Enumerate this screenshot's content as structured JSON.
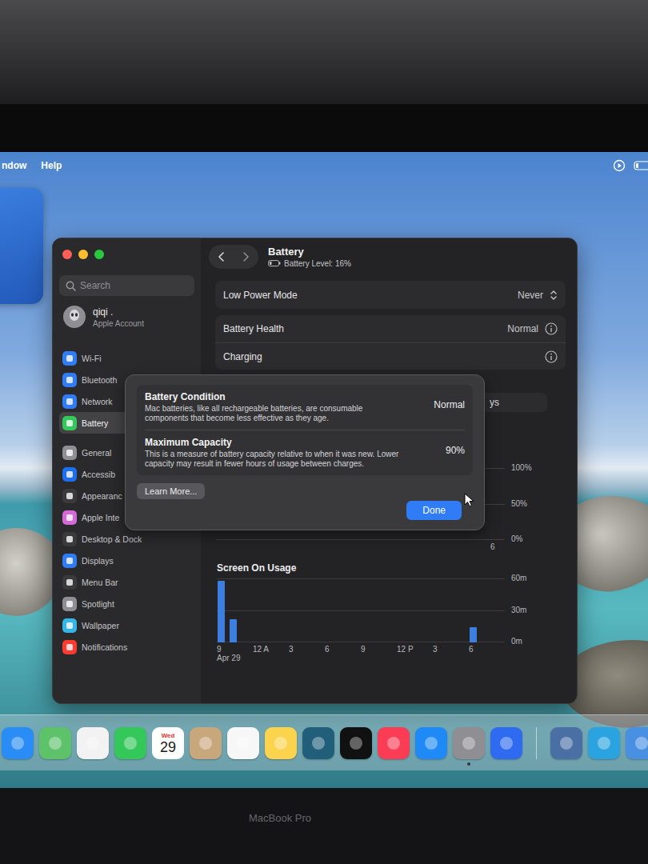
{
  "menu_bar": {
    "items": [
      "ndow",
      "Help"
    ]
  },
  "settings": {
    "sidebar": {
      "search": {
        "placeholder": "Search"
      },
      "account": {
        "name": "qiqi .",
        "subtitle": "Apple Account"
      },
      "items": [
        {
          "label": "Wi-Fi",
          "selected": false,
          "color": "#2f7cf6"
        },
        {
          "label": "Bluetooth",
          "selected": false,
          "color": "#2f7cf6"
        },
        {
          "label": "Network",
          "selected": false,
          "color": "#2f7cf6"
        },
        {
          "label": "Battery",
          "selected": true,
          "color": "#34c759"
        },
        {
          "label": "General",
          "selected": false,
          "color": "#8e8e93"
        },
        {
          "label": "Accessib",
          "selected": false,
          "color": "#1e6ff0"
        },
        {
          "label": "Appearanc",
          "selected": false,
          "color": "#3a3a3c"
        },
        {
          "label": "Apple Inte",
          "selected": false,
          "color": "#d46ad8"
        },
        {
          "label": "Desktop & Dock",
          "selected": false,
          "color": "#3a3a3c"
        },
        {
          "label": "Displays",
          "selected": false,
          "color": "#2f7cf6"
        },
        {
          "label": "Menu Bar",
          "selected": false,
          "color": "#3a3a3c"
        },
        {
          "label": "Spotlight",
          "selected": false,
          "color": "#8e8e93"
        },
        {
          "label": "Wallpaper",
          "selected": false,
          "color": "#35b6e8"
        },
        {
          "label": "Notifications",
          "selected": false,
          "color": "#ff3b30"
        }
      ]
    },
    "header": {
      "title": "Battery",
      "subtitle": "Battery Level: 16%"
    },
    "row_groups": [
      [
        {
          "label": "Low Power Mode",
          "value": "Never",
          "kind": "select"
        }
      ],
      [
        {
          "label": "Battery Health",
          "value": "Normal",
          "kind": "info"
        },
        {
          "label": "Charging",
          "kind": "info"
        }
      ]
    ],
    "range": {
      "visible_label": "ys"
    },
    "battery_chart": {
      "ticks": [
        "100%",
        "50%",
        "0%"
      ],
      "x_labels": [
        "6"
      ]
    },
    "screen_chart": {
      "title": "Screen On Usage",
      "ticks": [
        "60m",
        "30m",
        "0m"
      ],
      "max": 60,
      "x_labels": [
        "9",
        "12 A",
        "3",
        "6",
        "9",
        "12 P",
        "3",
        "6"
      ],
      "date": "Apr 29",
      "values": [
        58,
        22,
        0,
        0,
        0,
        0,
        0,
        0,
        0,
        0,
        0,
        0,
        0,
        0,
        0,
        0,
        0,
        0,
        0,
        0,
        0,
        14,
        0,
        0
      ]
    }
  },
  "dialog": {
    "rows": [
      {
        "title": "Battery Condition",
        "description": "Mac batteries, like all rechargeable batteries, are consumable components that become less effective as they age.",
        "value": "Normal"
      },
      {
        "title": "Maximum Capacity",
        "description": "This is a measure of battery capacity relative to when it was new. Lower capacity may result in fewer hours of usage between charges.",
        "value": "90%"
      }
    ],
    "learn_more": "Learn More...",
    "done": "Done"
  },
  "dock": {
    "items": [
      {
        "kind": "app",
        "color": "#2a8cf5",
        "running": false
      },
      {
        "kind": "app",
        "color": "#5dc26a",
        "running": false
      },
      {
        "kind": "app",
        "color": "#f2f2f2",
        "running": false
      },
      {
        "kind": "app",
        "color": "#34c759",
        "running": false
      },
      {
        "kind": "calendar",
        "day": "Wed",
        "date": "29",
        "running": false
      },
      {
        "kind": "app",
        "color": "#c9a77c",
        "running": false
      },
      {
        "kind": "app",
        "color": "#f7f7f7",
        "running": false
      },
      {
        "kind": "app",
        "color": "#fbd34d",
        "running": false
      },
      {
        "kind": "app",
        "color": "#205e7a",
        "running": false
      },
      {
        "kind": "app",
        "color": "#111111",
        "running": false
      },
      {
        "kind": "app",
        "color": "#fa3c55",
        "running": false
      },
      {
        "kind": "app",
        "color": "#1f8af5",
        "running": false
      },
      {
        "kind": "app",
        "color": "#8e8e93",
        "running": true
      },
      {
        "kind": "app",
        "color": "#2f6bf0",
        "running": false
      },
      {
        "kind": "separator"
      },
      {
        "kind": "app",
        "color": "#4a6fa5",
        "running": false
      },
      {
        "kind": "app",
        "color": "#2aa3e0",
        "running": false
      },
      {
        "kind": "app",
        "color": "#4a90e2",
        "running": false
      }
    ]
  },
  "bezel_label": "MacBook Pro"
}
